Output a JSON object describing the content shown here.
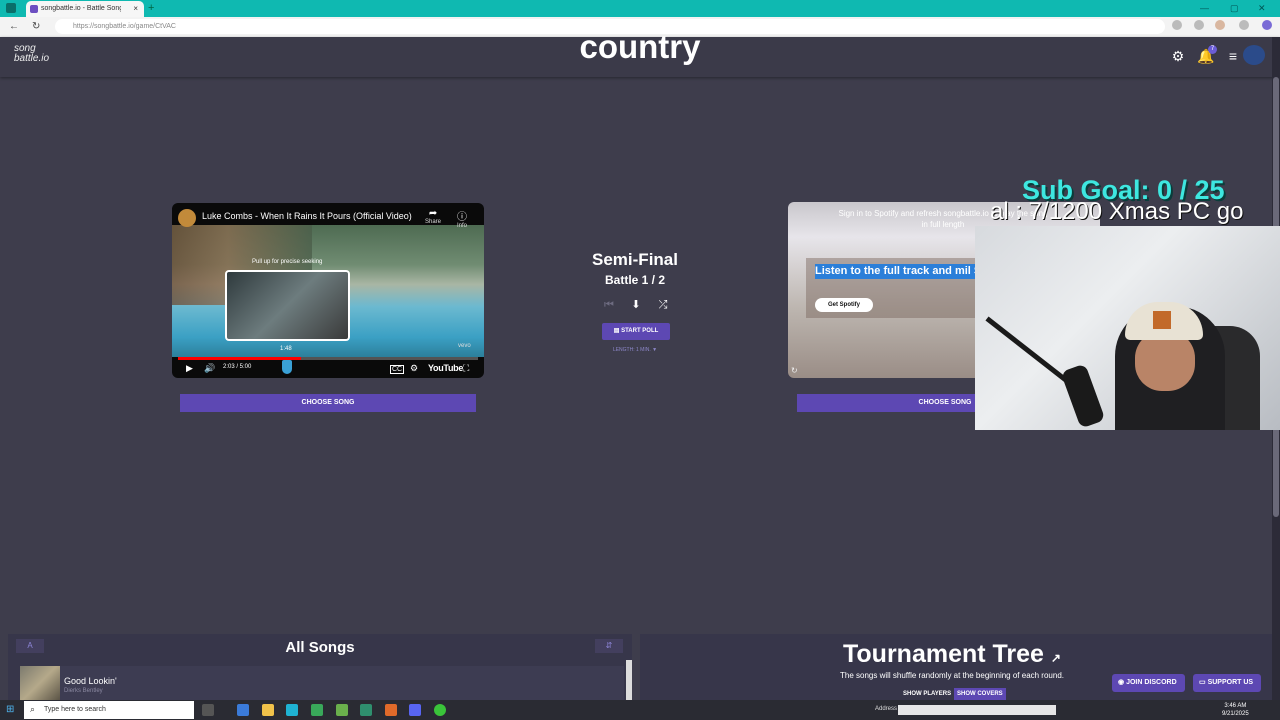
{
  "browser": {
    "tab_title": "songbattle.io - Battle Songs",
    "url": "https://songbattle.io/game/CtVAC",
    "new_tab": "+",
    "tab_close": "×",
    "win_minimize": "—",
    "win_maximize": "▢",
    "win_close": "✕"
  },
  "header": {
    "logo": "song battle.io",
    "page_title": "country",
    "notification_count": "7"
  },
  "left_video": {
    "title": "Luke Combs - When It Rains It Pours (Official Video)",
    "share_label": "Share",
    "info_label": "Info",
    "seek_hint": "Pull up for precise seeking",
    "preview_time": "1:48",
    "time": "2:03 / 5:00",
    "progress_fraction": 0.41,
    "watermark": "vevo",
    "youtube_label": "YouTube",
    "choose_label": "CHOOSE SONG"
  },
  "center": {
    "round": "Semi-Final",
    "battle": "Battle 1 / 2",
    "poll_label": "START POLL",
    "length_label": "LENGTH: 1 MIN. ▼"
  },
  "right_card": {
    "signin_text": "Sign in to Spotify and refresh songbattle.io to play the song in full length",
    "listen_text": "Listen to the full track and mil Spotify",
    "get_spotify": "Get Spotify",
    "choose_label": "CHOOSE SONG"
  },
  "overlay": {
    "sub_goal": "Sub Goal:  0 / 25",
    "ticker": "al : 7/1200 Xmas PC go"
  },
  "all_songs": {
    "title": "All Songs",
    "sort_left": "A",
    "sort_right": "⇵",
    "rows": [
      {
        "name": "Good Lookin'",
        "artist": "Dierks Bentley"
      }
    ]
  },
  "tournament": {
    "title": "Tournament Tree",
    "subtitle": "The songs will shuffle randomly at the beginning of each round.",
    "show_players": "SHOW PLAYERS",
    "show_covers": "SHOW COVERS"
  },
  "links": {
    "discord": "JOIN DISCORD",
    "support": "SUPPORT US"
  },
  "taskbar": {
    "search_placeholder": "Type here to search",
    "address_label": "Address",
    "time": "3:46 AM",
    "date": "9/21/2025"
  },
  "colors": {
    "accent": "#5d48b3",
    "page_bg": "#3e3d4c",
    "teal_tabbar": "#0fb9b1",
    "sub_goal": "#3ee7e0"
  }
}
